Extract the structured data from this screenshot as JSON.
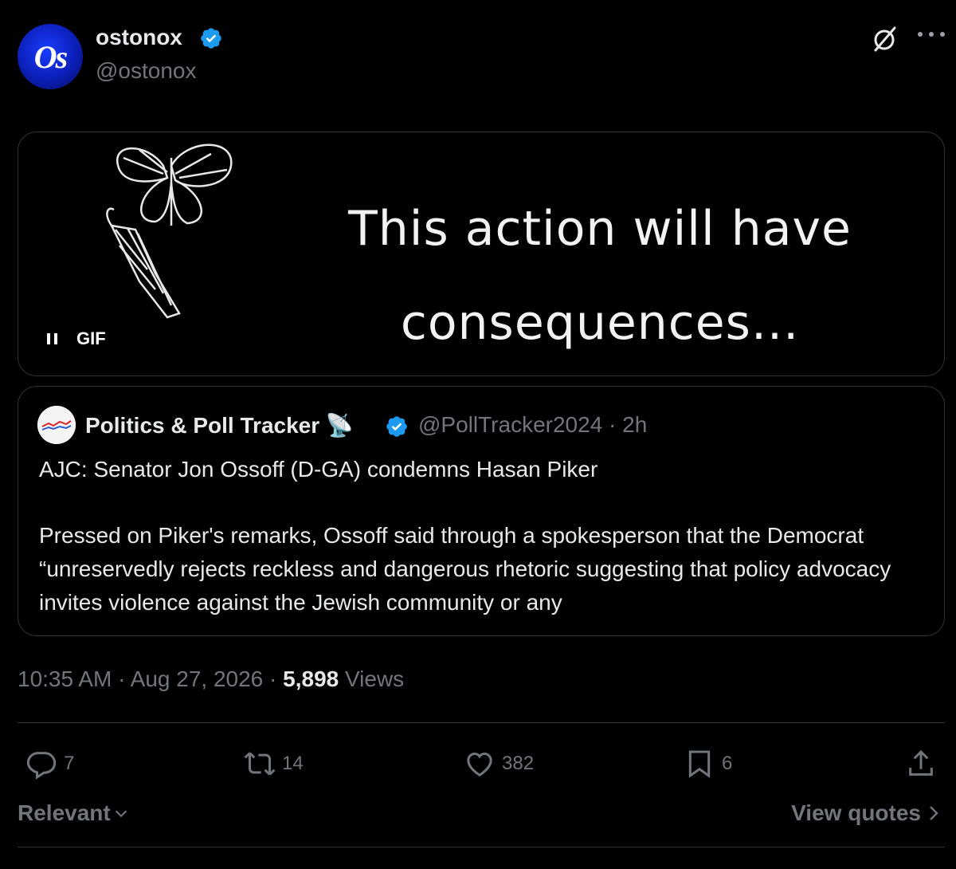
{
  "author": {
    "avatar_text": "Os",
    "display_name": "ostonox",
    "handle": "@ostonox",
    "verified": true
  },
  "header_icons": [
    "grok-icon",
    "more-icon"
  ],
  "media": {
    "gif_caption_line1": "This action will have",
    "gif_caption_line2": "consequences...",
    "badge_label": "GIF"
  },
  "quote": {
    "name": "Politics & Poll Tracker",
    "emoji": "📡",
    "handle_time": "@PollTracker2024 · 2h",
    "title": "AJC: Senator Jon Ossoff (D-GA) condemns Hasan Piker",
    "body": "Pressed on Piker's remarks, Ossoff said through a spokesperson that the Democrat “unreservedly rejects reckless and dangerous rhetoric suggesting that policy advocacy invites violence against the Jewish community or any"
  },
  "meta": {
    "time": "10:35 AM",
    "sep1": " · ",
    "date": "Aug 27, 2026",
    "sep2": " · ",
    "views_count": "5,898",
    "views_label": " Views"
  },
  "actions": {
    "replies": "7",
    "reposts": "14",
    "likes": "382",
    "bookmarks": "6"
  },
  "footer": {
    "sort_label": "Relevant",
    "view_quotes_label": "View quotes"
  },
  "colors": {
    "background": "#000000",
    "text": "#e7e9ea",
    "muted": "#71767b",
    "border": "#2f3336",
    "verified": "#1d9bf0"
  }
}
